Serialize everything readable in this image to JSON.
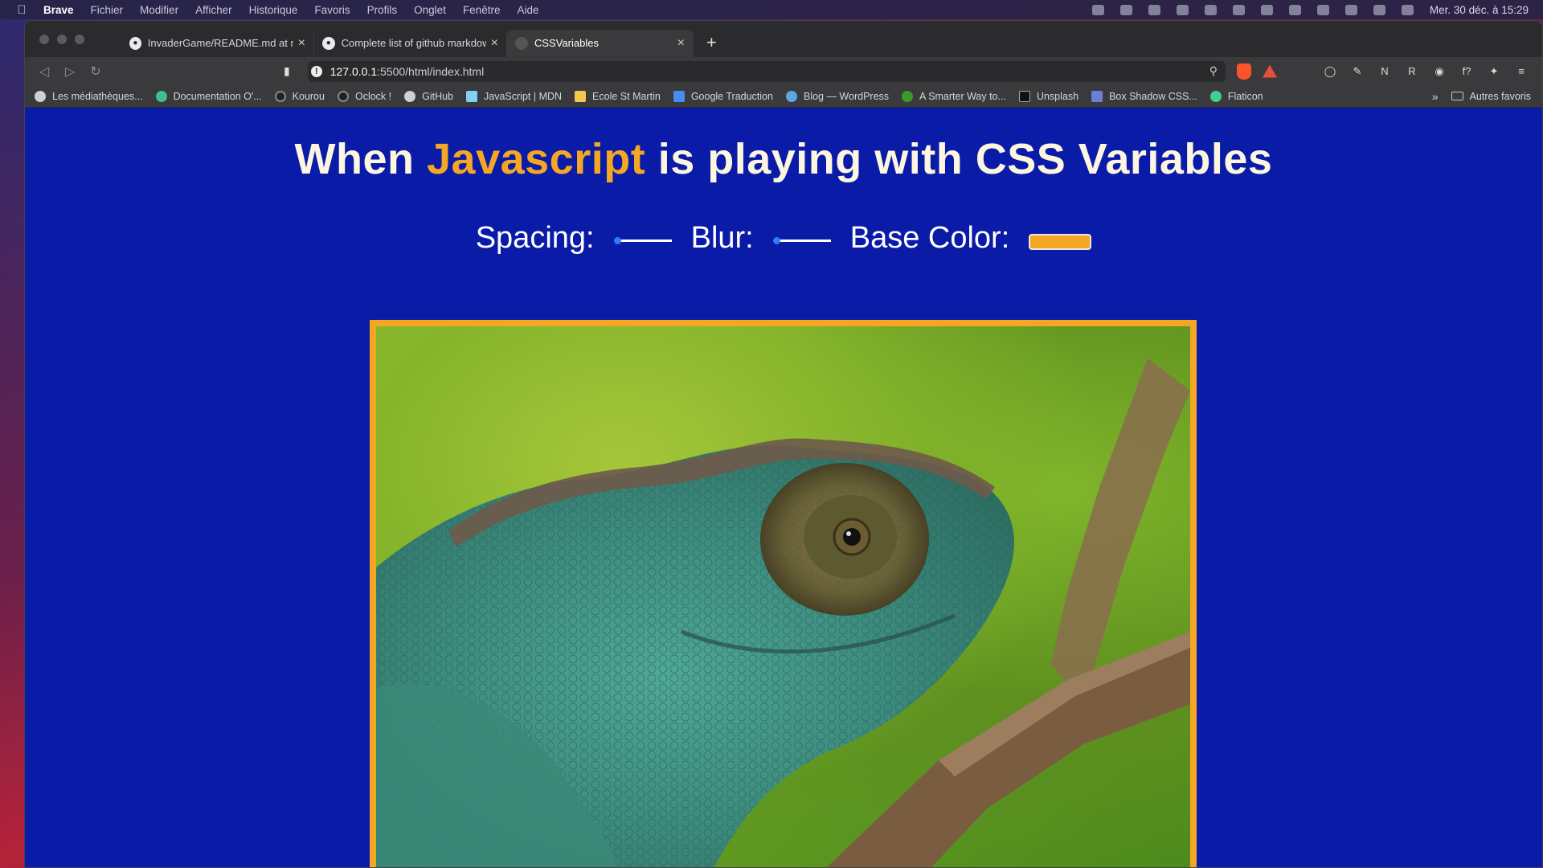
{
  "menubar": {
    "app": "Brave",
    "items": [
      "Fichier",
      "Modifier",
      "Afficher",
      "Historique",
      "Favoris",
      "Profils",
      "Onglet",
      "Fenêtre",
      "Aide"
    ],
    "clock": "Mer. 30 déc. à 15:29"
  },
  "tabs": [
    {
      "title": "InvaderGame/README.md at ma",
      "icon": "github-icon"
    },
    {
      "title": "Complete list of github markdow",
      "icon": "github-icon"
    },
    {
      "title": "CSSVariables",
      "icon": "globe-icon",
      "active": true
    }
  ],
  "url": {
    "host": "127.0.0.1",
    "rest": ":5500/html/index.html"
  },
  "bookmarks": [
    "Les médiathèques...",
    "Documentation O'...",
    "Kourou",
    "Oclock !",
    "GitHub",
    "JavaScript | MDN",
    "Ecole St Martin",
    "Google Traduction",
    "Blog — WordPress",
    "A Smarter Way to...",
    "Unsplash",
    "Box Shadow CSS...",
    "Flaticon"
  ],
  "bookmarks_more": "»",
  "bookmarks_other": "Autres favoris",
  "page": {
    "title_before": "When ",
    "title_highlight": "Javascript",
    "title_after": " is playing with CSS Variables",
    "spacing_label": "Spacing:",
    "blur_label": "Blur:",
    "base_color_label": "Base Color:",
    "spacing_value_fraction": 0.0,
    "blur_value_fraction": 0.0,
    "base_color": "#f5a623",
    "background_color": "#0a1ba8"
  }
}
